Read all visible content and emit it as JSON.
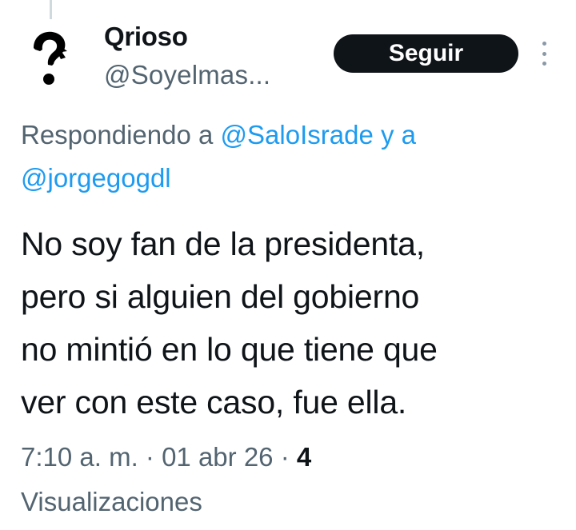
{
  "user": {
    "display_name": "Qrioso",
    "handle": "@Soyelmas..."
  },
  "actions": {
    "follow_label": "Seguir",
    "more_icon": "more-vertical-icon"
  },
  "avatar": {
    "icon": "question-mark-face-icon"
  },
  "reply": {
    "prefix": "Respondiendo a ",
    "mention1": "@SaloIsrade",
    "conjunction": " y a",
    "mention2": "@jorgegogdl"
  },
  "tweet": {
    "lines": [
      "No soy fan de la presidenta,",
      "pero si alguien del gobierno",
      "no mintió en lo que tiene que",
      "ver con este caso, fue ella."
    ]
  },
  "meta": {
    "time": "7:10 a. m.",
    "separator": " · ",
    "date": "01 abr 26",
    "views_count": "4",
    "views_label": "Visualizaciones"
  },
  "colors": {
    "text": "#0f1419",
    "secondary": "#536471",
    "link": "#1d9bf0",
    "button_bg": "#0f1419"
  }
}
